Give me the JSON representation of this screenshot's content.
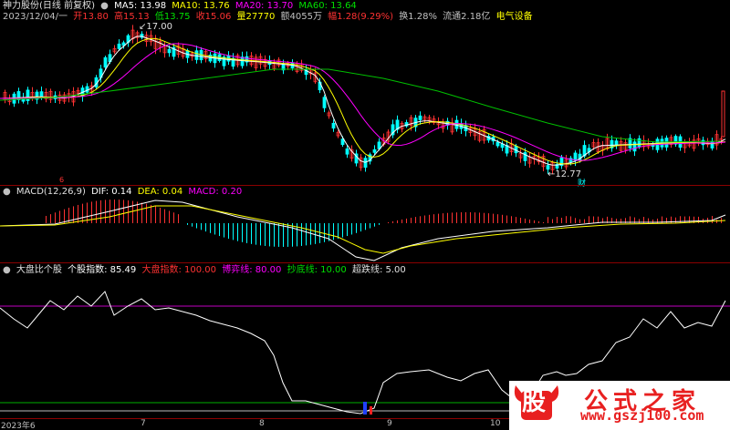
{
  "header": {
    "stock": "神力股份(日线 前复权)",
    "ma5": "MA5: 13.98",
    "ma10": "MA10: 13.76",
    "ma20": "MA20: 13.70",
    "ma60": "MA60: 13.64",
    "date": "2023/12/04/一",
    "open": "开13.80",
    "high": "高15.13",
    "low": "低13.75",
    "close": "收15.06",
    "vol": "量27770",
    "amt": "额4055万",
    "chg": "幅1.28(9.29%)",
    "turn": "换1.28%",
    "float": "流通2.18亿",
    "sector": "电气设备"
  },
  "price_pane": {
    "high_mark": "17.00",
    "low_mark": "12.77",
    "cai_marker": "财",
    "tick_mark": "6"
  },
  "macd": {
    "title": "MACD(12,26,9)",
    "dif": "DIF: 0.14",
    "dea": "DEA: 0.04",
    "macd": "MACD: 0.20"
  },
  "indicator": {
    "title": "大盘比个股",
    "stock_idx": "个股指数: 85.49",
    "market_idx": "大盘指数: 100.00",
    "game_line": "博弈线: 80.00",
    "bottom_line": "抄底线: 10.00",
    "oversold_line": "超跌线: 5.00"
  },
  "xaxis": [
    "2023年6",
    "7",
    "8",
    "9",
    "10"
  ],
  "watermark": {
    "badge": "股",
    "name": "公式之家",
    "url": "www.gszj100.com"
  },
  "colors": {
    "up": "#ff3232",
    "down": "#00ffff",
    "ma5": "#ffffff",
    "ma10": "#ffff00",
    "ma20": "#ff00ff",
    "ma60": "#00c000",
    "frame": "#8b0000",
    "magenta_line": "#c000c0",
    "green_line": "#00b000"
  }
}
